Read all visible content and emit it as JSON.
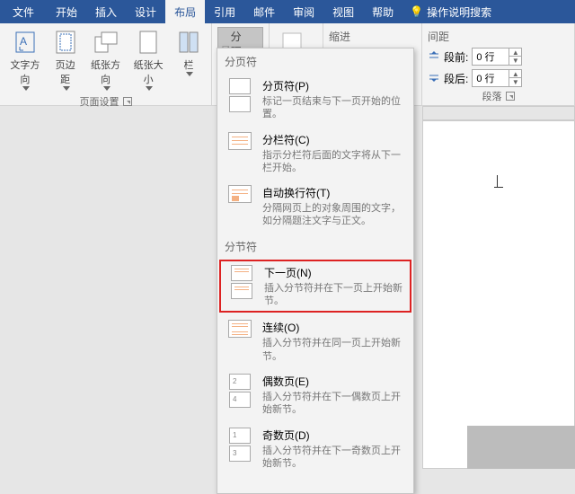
{
  "tabs": {
    "file": "文件",
    "home": "开始",
    "insert": "插入",
    "design": "设计",
    "layout": "布局",
    "references": "引用",
    "mailings": "邮件",
    "review": "审阅",
    "view": "视图",
    "help": "帮助",
    "tell_me": "操作说明搜索"
  },
  "page_setup": {
    "text_direction": "文字方向",
    "margins": "页边距",
    "orientation": "纸张方向",
    "size": "纸张大小",
    "columns": "栏",
    "group_label": "页面设置",
    "breaks_label": "分隔符"
  },
  "breaks_menu": {
    "section_page_breaks": "分页符",
    "page_break": {
      "title": "分页符(P)",
      "desc": "标记一页结束与下一页开始的位置。"
    },
    "column_break": {
      "title": "分栏符(C)",
      "desc": "指示分栏符后面的文字将从下一栏开始。"
    },
    "text_wrap": {
      "title": "自动换行符(T)",
      "desc": "分隔网页上的对象周围的文字，如分隔题注文字与正文。"
    },
    "section_section_breaks": "分节符",
    "next_page": {
      "title": "下一页(N)",
      "desc": "插入分节符并在下一页上开始新节。"
    },
    "continuous": {
      "title": "连续(O)",
      "desc": "插入分节符并在同一页上开始新节。"
    },
    "even_page": {
      "title": "偶数页(E)",
      "desc": "插入分节符并在下一偶数页上开始新节。"
    },
    "odd_page": {
      "title": "奇数页(D)",
      "desc": "插入分节符并在下一奇数页上开始新节。"
    }
  },
  "indent": {
    "label": "缩进"
  },
  "spacing": {
    "label": "间距",
    "before_label": "段前:",
    "before_value": "0 行",
    "after_label": "段后:",
    "after_value": "0 行"
  },
  "paragraph_label": "段落"
}
